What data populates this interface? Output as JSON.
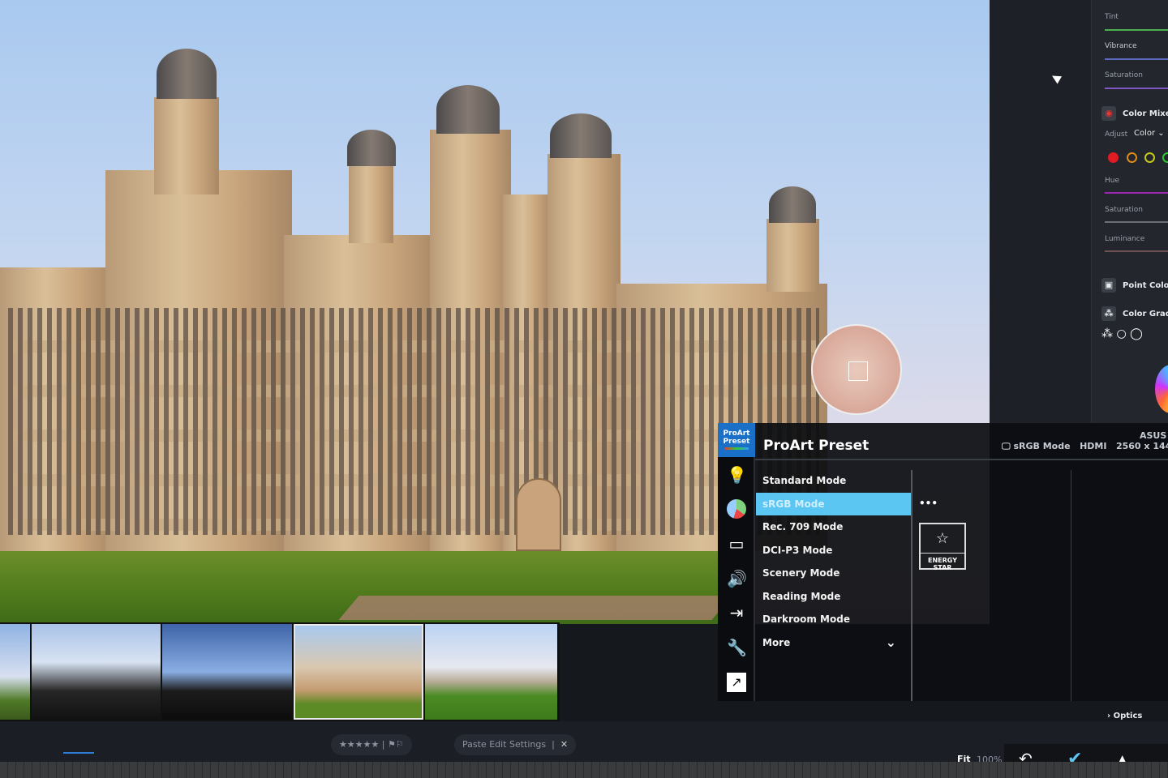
{
  "lightroom_panel": {
    "sliders": [
      {
        "label": "Tint",
        "color": "#4caf50"
      },
      {
        "label": "Vibrance",
        "color": "#5c6bc0"
      },
      {
        "label": "Saturation",
        "color": "#7e57c2"
      }
    ],
    "color_mixer": {
      "title": "Color Mixer",
      "adjust_label": "Adjust",
      "adjust_value": "Color",
      "swatches": [
        "#e01b24",
        "#e08a1b",
        "#c8c81b",
        "#2ec82e"
      ],
      "sliders": [
        {
          "label": "Hue",
          "color": "#9c27b0"
        },
        {
          "label": "Saturation",
          "color": "#6d6f78"
        },
        {
          "label": "Luminance",
          "color": "#6d5050"
        }
      ]
    },
    "point_color": "Point Color",
    "color_grading": "Color Gradi",
    "optics": "Optics"
  },
  "toolbar": {
    "stars": "★★★★★",
    "flags": "⚑⚐",
    "paste": "Paste Edit Settings",
    "close": "✕",
    "fit": "Fit",
    "zoom": "100%"
  },
  "osd": {
    "logo_line1": "ProArt",
    "logo_line2": "Preset",
    "title": "ProArt Preset",
    "brand": "ASUS",
    "status": {
      "mode": "sRGB Mode",
      "input": "HDMI",
      "resolution": "2560 x 144"
    },
    "menu": [
      {
        "label": "Standard Mode",
        "selected": false
      },
      {
        "label": "sRGB Mode",
        "selected": true
      },
      {
        "label": "Rec. 709 Mode",
        "selected": false
      },
      {
        "label": "DCI-P3 Mode",
        "selected": false
      },
      {
        "label": "Scenery Mode",
        "selected": false
      },
      {
        "label": "Reading Mode",
        "selected": false
      },
      {
        "label": "Darkroom Mode",
        "selected": false
      },
      {
        "label": "More",
        "selected": false
      }
    ],
    "more_dots": "•••",
    "energy_star": "ENERGY STAR",
    "accent": "#5cc6f2"
  }
}
